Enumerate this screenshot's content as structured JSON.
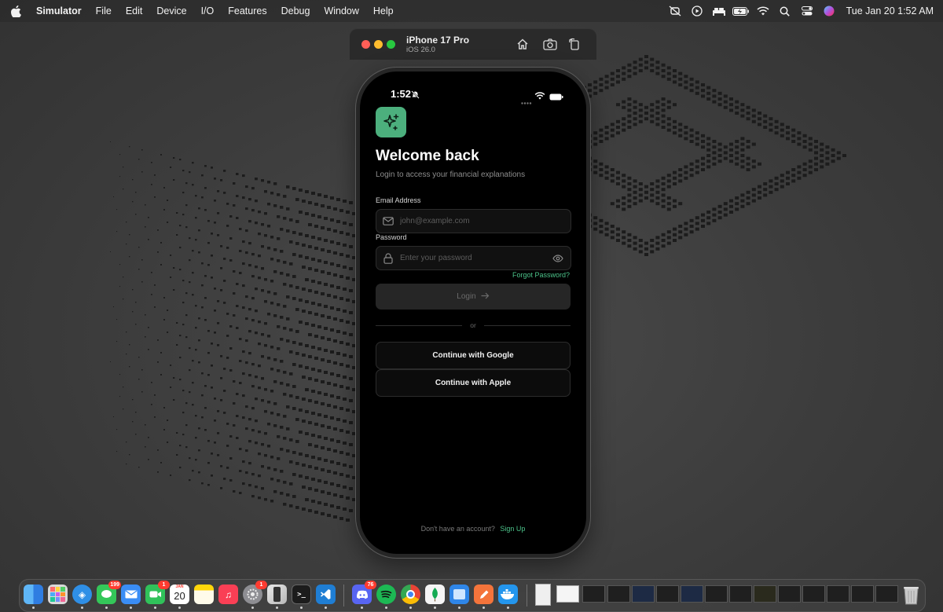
{
  "menubar": {
    "app_name": "Simulator",
    "menus": [
      "File",
      "Edit",
      "Device",
      "I/O",
      "Features",
      "Debug",
      "Window",
      "Help"
    ],
    "clock": "Tue Jan 20  1:52 AM",
    "status_icons": [
      "stage-manager-icon",
      "play-icon",
      "bed-icon",
      "battery-charging-icon",
      "wifi-icon",
      "search-icon",
      "control-center-icon",
      "siri-icon"
    ]
  },
  "simulator": {
    "device_name": "iPhone 17 Pro",
    "os_version": "iOS 26.0",
    "toolbar_icons": [
      "home-icon",
      "screenshot-icon",
      "rotate-icon"
    ]
  },
  "phone": {
    "status_time": "1:52",
    "title": "Welcome back",
    "subtitle": "Login to access your financial explanations",
    "email": {
      "label": "Email Address",
      "placeholder": "john@example.com",
      "value": ""
    },
    "password": {
      "label": "Password",
      "placeholder": "Enter your password",
      "value": ""
    },
    "forgot_label": "Forgot Password?",
    "login_label": "Login",
    "divider_text": "or",
    "google_label": "Continue with Google",
    "apple_label": "Continue with Apple",
    "signup_prompt": "Don't have an account?",
    "signup_label": "Sign Up",
    "accent_color": "#4cc38a"
  },
  "dock": {
    "apps": [
      {
        "name": "finder"
      },
      {
        "name": "launchpad"
      },
      {
        "name": "safari"
      },
      {
        "name": "messages",
        "badge": "199"
      },
      {
        "name": "mail"
      },
      {
        "name": "facetime",
        "badge": "1"
      },
      {
        "name": "calendar",
        "month": "JAN",
        "day": "20"
      },
      {
        "name": "notes"
      },
      {
        "name": "music"
      },
      {
        "name": "system-settings",
        "badge": "1"
      },
      {
        "name": "simulator"
      },
      {
        "name": "terminal"
      },
      {
        "name": "vscode"
      },
      {
        "name": "discord",
        "badge": "76"
      },
      {
        "name": "spotify"
      },
      {
        "name": "chrome"
      },
      {
        "name": "mongodb-compass"
      },
      {
        "name": "files"
      },
      {
        "name": "pencil"
      },
      {
        "name": "docker"
      }
    ]
  }
}
